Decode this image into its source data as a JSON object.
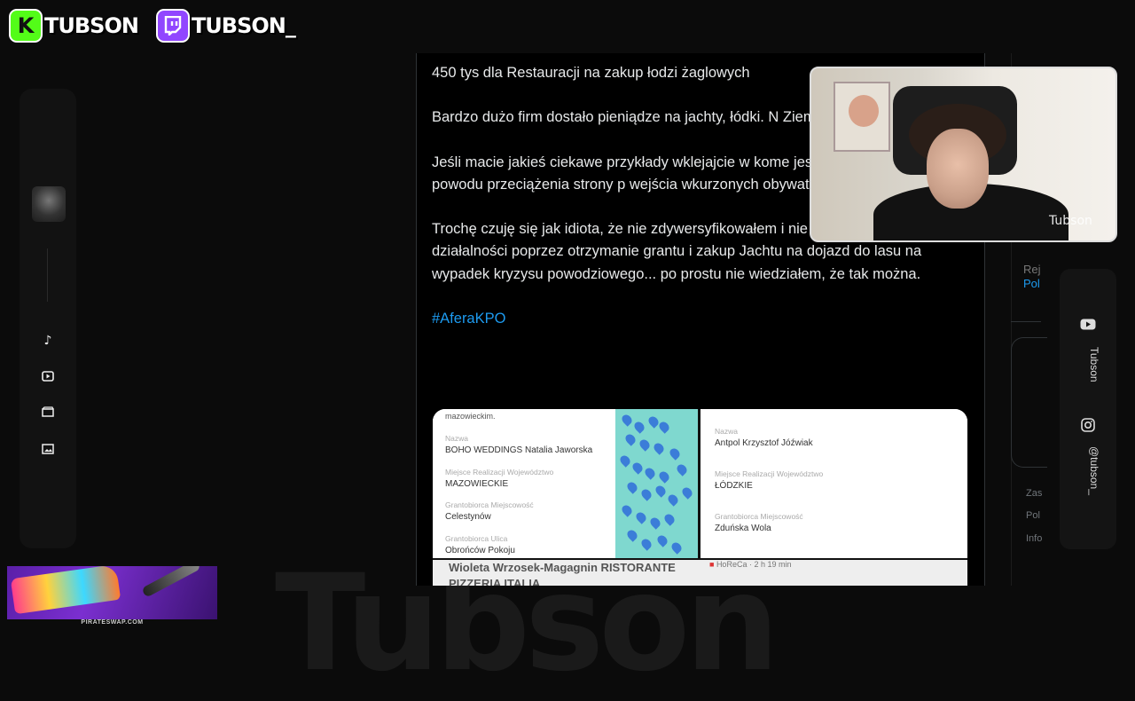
{
  "overlay": {
    "kick_icon": "K",
    "kick_handle": "TUBSON",
    "twitch_handle": "TUBSON_",
    "watermark": "Tubson",
    "ad_caption": "PIRATESWAP.COM",
    "cam_logo": "Tubson"
  },
  "tweet": {
    "paragraphs": [
      "450 tys dla Restauracji na zakup łodzi żaglowych",
      "Bardzo dużo firm dostało pieniądze na jachty, łódki. N Ziemniaka.",
      "Jeśli macie jakieś ciekawe przykłady wklejajcie w kome jest lekko wstrzymana z powodu przeciążenia strony p wejścia wkurzonych obywateli.",
      "Trochę czuję się jak idiota, że nie zdywersyfikowałem i nie zabezpieczyłem mojej działalności poprzez otrzymanie grantu i zakup Jachtu na dojazd do lasu na wypadek kryzysu powodziowego... po prostu nie wiedziałem, że tak można."
    ],
    "hashtag": "#AferaKPO"
  },
  "attachment": {
    "left": {
      "top_text": "mazowieckim.",
      "fields": [
        {
          "label": "Nazwa",
          "value": "BOHO WEDDINGS Natalia Jaworska"
        },
        {
          "label": "Miejsce Realizacji Województwo",
          "value": "MAZOWIECKIE"
        },
        {
          "label": "Grantobiorca Miejscowość",
          "value": "Celestynów"
        },
        {
          "label": "Grantobiorca Ulica",
          "value": "Obrońców Pokoju"
        }
      ],
      "bottom_text": "Wioleta Wrzosek-Magagnin RISTORANTE PIZZERIA ITALIA"
    },
    "right": {
      "fields": [
        {
          "label": "Nazwa",
          "value": "Antpol Krzysztof Jóźwiak"
        },
        {
          "label": "Miejsce Realizacji Województwo",
          "value": "ŁÓDZKIE"
        },
        {
          "label": "Grantobiorca Miejscowość",
          "value": "Zduńska Wola"
        }
      ],
      "bottom_text": "HoReCa · 2 h 19 min"
    }
  },
  "right_panel": {
    "reg_text": "Rej",
    "reg_link": "Pol",
    "footer": [
      "Zas",
      "Pol",
      "Info"
    ]
  },
  "social": {
    "youtube_label": "Tubson",
    "instagram_label": "@tubson_"
  }
}
